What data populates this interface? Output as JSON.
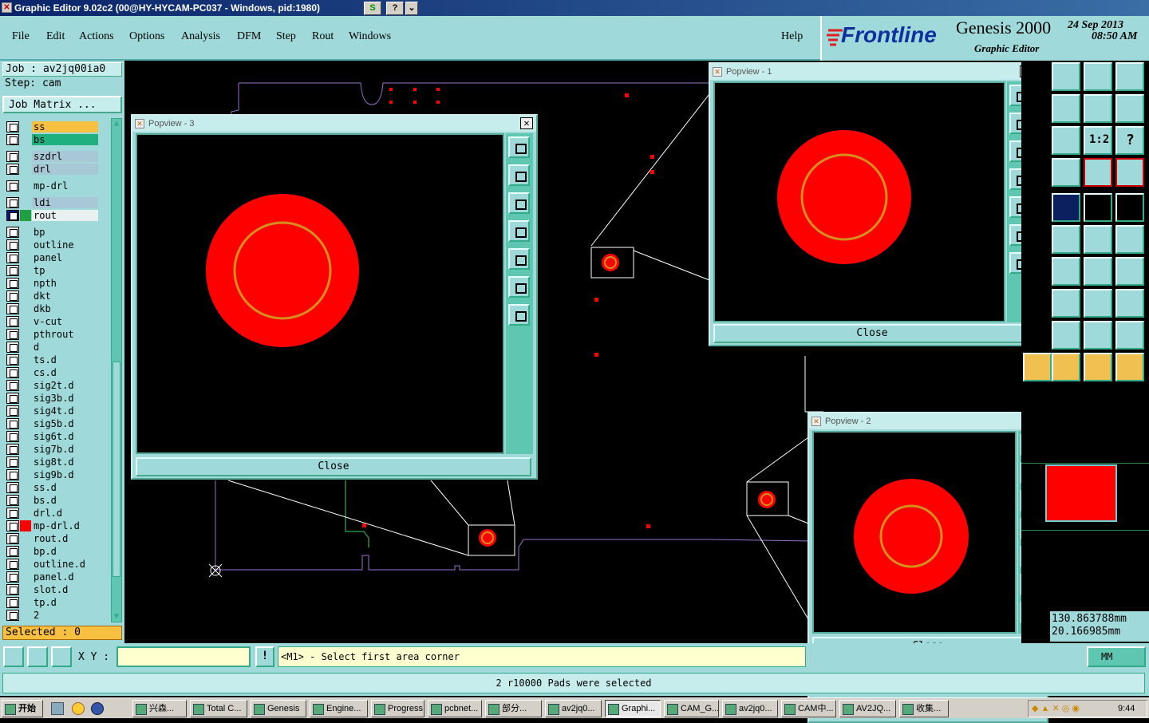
{
  "window": {
    "title": "Graphic Editor 9.02c2 (00@HY-HYCAM-PC037 - Windows, pid:1980)",
    "btn_s": "S",
    "btn_help": "?",
    "btn_menu": "⌄"
  },
  "menu": {
    "items": [
      "File",
      "Edit",
      "Actions",
      "Options",
      "Analysis",
      "DFM",
      "Step",
      "Rout",
      "Windows"
    ],
    "help": "Help"
  },
  "brand": {
    "logo": "Frontline",
    "product": "Genesis 2000",
    "subtitle": "Graphic Editor",
    "date": "24 Sep 2013",
    "time": "08:50 AM"
  },
  "job": {
    "job_line": "Job : av2jq00ia0",
    "step_line": "Step: cam",
    "matrix_button": "Job Matrix ..."
  },
  "layers": [
    {
      "name": "ss",
      "color": "#f8c040"
    },
    {
      "name": "bs",
      "color": "#20b080"
    },
    {
      "name": "szdrl",
      "color": "#a8c8d8"
    },
    {
      "name": "drl",
      "color": "#a8c8d8"
    },
    {
      "name": "mp-drl",
      "color": "#9fd9d9"
    },
    {
      "name": "ldi",
      "color": "#a8c8d8"
    },
    {
      "name": "rout",
      "color": "#e8f0f0"
    },
    {
      "name": "bp"
    },
    {
      "name": "outline"
    },
    {
      "name": "panel"
    },
    {
      "name": "tp"
    },
    {
      "name": "npth"
    },
    {
      "name": "dkt"
    },
    {
      "name": "dkb"
    },
    {
      "name": "v-cut"
    },
    {
      "name": "pthrout"
    },
    {
      "name": "d"
    },
    {
      "name": "ts.d"
    },
    {
      "name": "cs.d"
    },
    {
      "name": "sig2t.d"
    },
    {
      "name": "sig3b.d"
    },
    {
      "name": "sig4t.d"
    },
    {
      "name": "sig5b.d"
    },
    {
      "name": "sig6t.d"
    },
    {
      "name": "sig7b.d"
    },
    {
      "name": "sig8t.d"
    },
    {
      "name": "sig9b.d"
    },
    {
      "name": "ss.d"
    },
    {
      "name": "bs.d"
    },
    {
      "name": "drl.d"
    },
    {
      "name": "mp-drl.d"
    },
    {
      "name": "rout.d"
    },
    {
      "name": "bp.d"
    },
    {
      "name": "outline.d"
    },
    {
      "name": "panel.d"
    },
    {
      "name": "slot.d"
    },
    {
      "name": "tp.d"
    },
    {
      "name": "2"
    }
  ],
  "selected": "Selected : 0",
  "popups": [
    {
      "title": "Popview - 3",
      "close": "Close"
    },
    {
      "title": "Popview - 1",
      "close": "Close"
    },
    {
      "title": "Popview - 2",
      "close": "Close"
    }
  ],
  "coords": {
    "x": "130.863788mm",
    "y": "20.166985mm"
  },
  "status": {
    "xy_label": "X Y :",
    "input_value": "",
    "exclaim": "!",
    "prompt": "<M1> - Select first area corner",
    "units": "MM"
  },
  "message": "2 r10000 Pads were selected",
  "taskbar": {
    "start": "开始",
    "clock": "9:44",
    "tasks": [
      "兴森...",
      "Total C...",
      "Genesis",
      "Engine...",
      "Progress",
      "pcbnet...",
      "部分...",
      "av2jq0...",
      "Graphi...",
      "CAM_G...",
      "av2jq0...",
      "CAM中...",
      "AV2JQ...",
      "收集..."
    ]
  },
  "colors": {
    "panel": "#9fd9d9",
    "pad": "#ff0000",
    "ring": "#d4901a",
    "outline": "#9a70d0"
  }
}
